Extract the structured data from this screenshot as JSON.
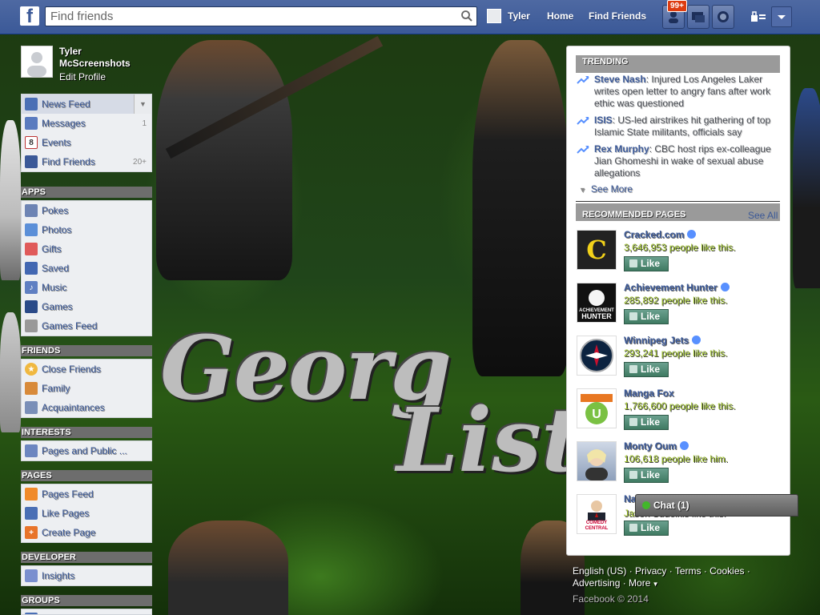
{
  "search": {
    "placeholder": "Find friends"
  },
  "topbar": {
    "user_name": "Tyler",
    "home": "Home",
    "find_friends": "Find Friends",
    "notif_badge": "99+"
  },
  "profile": {
    "name_line1": "Tyler",
    "name_line2": "McScreenshots",
    "edit": "Edit Profile"
  },
  "favorites": [
    {
      "label": "News Feed",
      "icon": "news-feed-icon",
      "count": ""
    },
    {
      "label": "Messages",
      "icon": "messages-icon",
      "count": "1"
    },
    {
      "label": "Events",
      "icon": "events-icon",
      "count": "",
      "glyph": "8"
    },
    {
      "label": "Find Friends",
      "icon": "find-friends-icon",
      "count": "20+"
    }
  ],
  "sections": {
    "apps": "APPS",
    "friends": "FRIENDS",
    "interests": "INTERESTS",
    "pages": "PAGES",
    "developer": "DEVELOPER",
    "groups": "GROUPS"
  },
  "apps": [
    {
      "label": "Pokes",
      "icon": "pokes-icon"
    },
    {
      "label": "Photos",
      "icon": "photos-icon"
    },
    {
      "label": "Gifts",
      "icon": "gifts-icon"
    },
    {
      "label": "Saved",
      "icon": "saved-icon"
    },
    {
      "label": "Music",
      "icon": "music-icon"
    },
    {
      "label": "Games",
      "icon": "games-icon"
    },
    {
      "label": "Games Feed",
      "icon": "games-feed-icon"
    }
  ],
  "friends": [
    {
      "label": "Close Friends",
      "icon": "star-icon"
    },
    {
      "label": "Family",
      "icon": "family-icon"
    },
    {
      "label": "Acquaintances",
      "icon": "acquaintances-icon"
    }
  ],
  "interests": [
    {
      "label": "Pages and Public ...",
      "icon": "rss-icon"
    }
  ],
  "pages": [
    {
      "label": "Pages Feed",
      "icon": "pages-feed-icon"
    },
    {
      "label": "Like Pages",
      "icon": "like-pages-icon"
    },
    {
      "label": "Create Page",
      "icon": "create-page-icon"
    }
  ],
  "developer": [
    {
      "label": "Insights",
      "icon": "insights-icon"
    }
  ],
  "trending": {
    "title": "TRENDING",
    "items": [
      {
        "topic": "Steve Nash",
        "text": ": Injured Los Angeles Laker writes open letter to angry fans after work ethic was questioned"
      },
      {
        "topic": "ISIS",
        "text": ": US-led airstrikes hit gathering of top Islamic State militants, officials say"
      },
      {
        "topic": "Rex Murphy",
        "text": ": CBC host rips ex-colleague Jian Ghomeshi in wake of sexual abuse allegations"
      }
    ],
    "see_more": "See More"
  },
  "recommended": {
    "title": "RECOMMENDED PAGES",
    "see_all": "See All",
    "like_label": "Like",
    "pages": [
      {
        "name": "Cracked.com",
        "likes": "3,646,953 people like this."
      },
      {
        "name": "Achievement Hunter",
        "likes": "285,892 people like this."
      },
      {
        "name": "Winnipeg Jets",
        "likes": "293,241 people like this."
      },
      {
        "name": "Manga Fox",
        "likes": "1,766,600 people like this."
      },
      {
        "name": "Monty Oum",
        "likes": "106,618 people like him."
      },
      {
        "name": "Na",
        "likes": ""
      }
    ],
    "thumb_text": {
      "cracked": "C",
      "ah_line1": "ACHIEVEMENT",
      "ah_line2": "HUNTER",
      "comedy_line1": "COMEDY",
      "comedy_line2": "CENTRAL"
    },
    "partial_behind_chat": "Jason Sudeikis like this."
  },
  "chat": {
    "label": "Chat (1)"
  },
  "footer": {
    "links": [
      "English (US)",
      "Privacy",
      "Terms",
      "Cookies",
      "Advertising",
      "More"
    ],
    "copyright": "Facebook © 2014"
  },
  "colors": {
    "brand": "#3b5998",
    "likes_text": "#9cc02a",
    "badge": "#dd3c10"
  }
}
